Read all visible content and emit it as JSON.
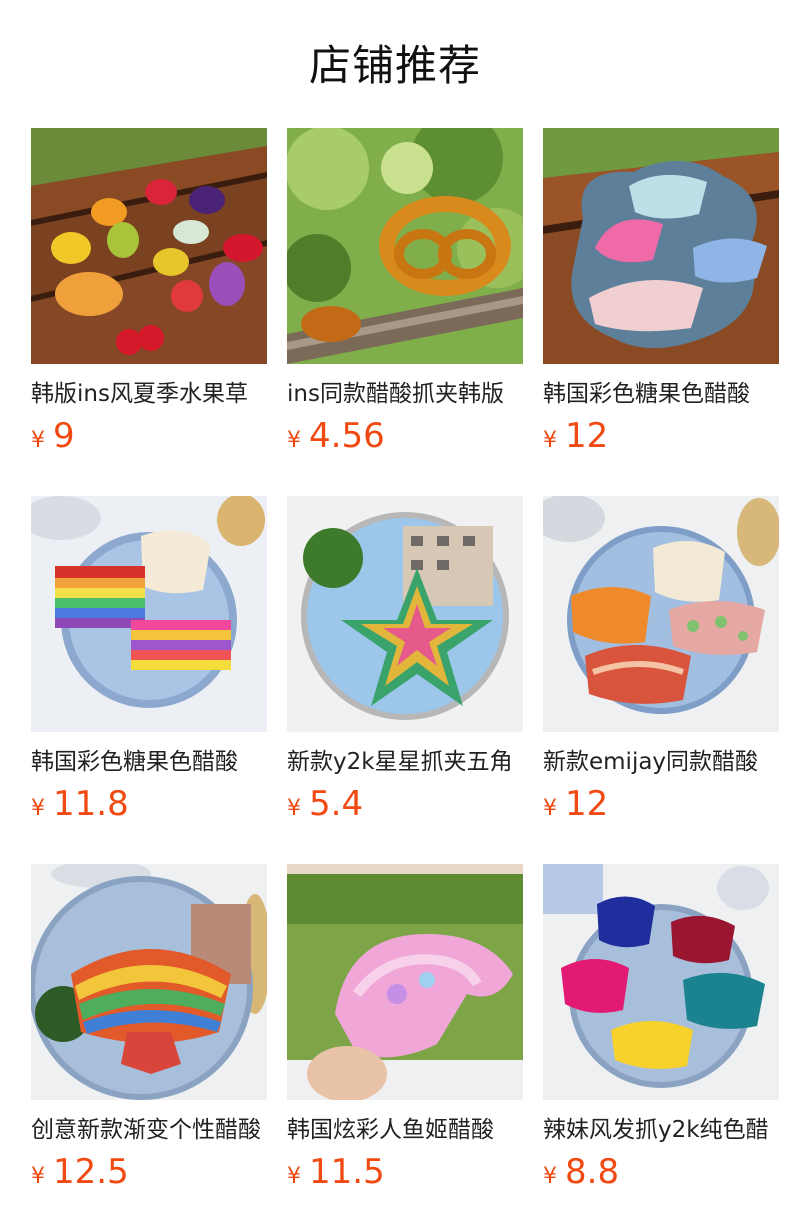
{
  "page": {
    "title": "店铺推荐"
  },
  "colors": {
    "price": "#f04a12",
    "title": "#111111",
    "name": "#222222"
  },
  "products": [
    {
      "name": "韩版ins风夏季水果草",
      "currency": "¥",
      "price": "9",
      "image_icon": "fruit-hair-clips-image"
    },
    {
      "name": "ins同款醋酸抓夹韩版",
      "currency": "¥",
      "price": "4.56",
      "image_icon": "pretzel-hair-clip-image"
    },
    {
      "name": "韩国彩色糖果色醋酸",
      "currency": "¥",
      "price": "12",
      "image_icon": "candy-color-clips-image"
    },
    {
      "name": "韩国彩色糖果色醋酸",
      "currency": "¥",
      "price": "11.8",
      "image_icon": "rainbow-clips-image"
    },
    {
      "name": "新款y2k星星抓夹五角",
      "currency": "¥",
      "price": "5.4",
      "image_icon": "star-clip-image"
    },
    {
      "name": "新款emijay同款醋酸",
      "currency": "¥",
      "price": "12",
      "image_icon": "pattern-clips-image"
    },
    {
      "name": "创意新款渐变个性醋酸",
      "currency": "¥",
      "price": "12.5",
      "image_icon": "gradient-clip-image"
    },
    {
      "name": "韩国炫彩人鱼姬醋酸",
      "currency": "¥",
      "price": "11.5",
      "image_icon": "mermaid-clip-image"
    },
    {
      "name": "辣妹风发抓y2k纯色醋",
      "currency": "¥",
      "price": "8.8",
      "image_icon": "solid-color-clips-image"
    }
  ]
}
